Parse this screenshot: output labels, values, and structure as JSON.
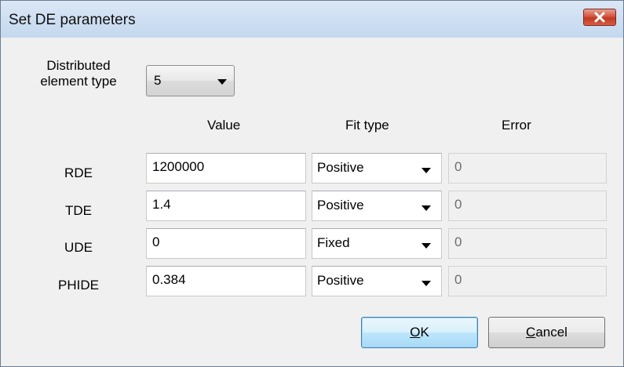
{
  "window": {
    "title": "Set DE parameters",
    "close_label": "close"
  },
  "de_type": {
    "label_line1": "Distributed",
    "label_line2": "element type",
    "selected": "5"
  },
  "headers": {
    "value": "Value",
    "fit_type": "Fit type",
    "error": "Error"
  },
  "rows": [
    {
      "name": "RDE",
      "value": "1200000",
      "fit_type": "Positive",
      "error": "0"
    },
    {
      "name": "TDE",
      "value": "1.4",
      "fit_type": "Positive",
      "error": "0"
    },
    {
      "name": "UDE",
      "value": "0",
      "fit_type": "Fixed",
      "error": "0"
    },
    {
      "name": "PHIDE",
      "value": "0.384",
      "fit_type": "Positive",
      "error": "0"
    }
  ],
  "buttons": {
    "ok_mnemonic": "O",
    "ok_rest": "K",
    "cancel_mnemonic": "C",
    "cancel_rest": "ancel"
  },
  "colors": {
    "titlebar": "#cfdff2",
    "close_button": "#c13a22",
    "default_button_border": "#3c7fb1",
    "dialog_background": "#f0f0f0"
  },
  "icons": {
    "close": "close-icon",
    "dropdown": "chevron-down-icon"
  }
}
